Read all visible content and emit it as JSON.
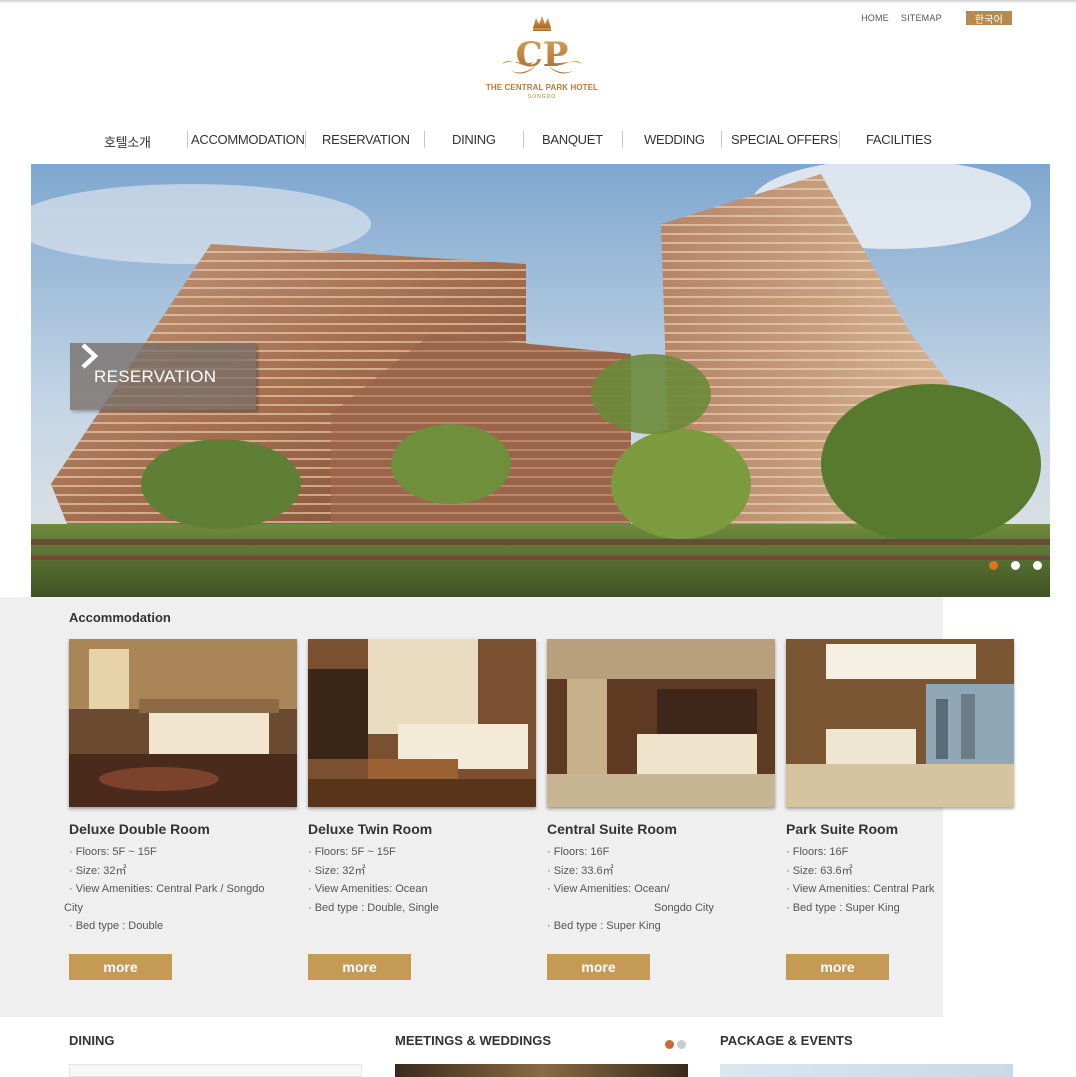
{
  "utility": {
    "home": "HOME",
    "sitemap": "SITEMAP",
    "language": "한국어"
  },
  "logo": {
    "monogram": "CP",
    "name": "THE CENTRAL PARK HOTEL",
    "location": "SONGDO"
  },
  "nav": [
    {
      "label": "호텔소개"
    },
    {
      "label": "ACCOMMODATION"
    },
    {
      "label": "RESERVATION"
    },
    {
      "label": "DINING"
    },
    {
      "label": "BANQUET"
    },
    {
      "label": "WEDDING"
    },
    {
      "label": "SPECIAL OFFERS"
    },
    {
      "label": "FACILITIES"
    }
  ],
  "hero": {
    "button_label": "RESERVATION",
    "slides": 3,
    "active_slide": 1
  },
  "accommodation": {
    "title": "Accommodation",
    "rooms": [
      {
        "name": "Deluxe Double Room",
        "specs": [
          "· Floors: 5F ~ 15F",
          "· Size: 32㎡",
          "· View Amenities: Central Park / Songdo",
          "City",
          "· Bed type : Double"
        ],
        "more": "more"
      },
      {
        "name": "Deluxe Twin Room",
        "specs": [
          "· Floors: 5F ~ 15F",
          "· Size: 32㎡",
          "· View Amenities: Ocean",
          "· Bed type : Double, Single"
        ],
        "more": "more"
      },
      {
        "name": "Central Suite Room",
        "specs": [
          "· Floors: 16F",
          "· Size: 33.6㎡",
          "· View Amenities: Ocean/",
          "Songdo City",
          "· Bed type : Super King"
        ],
        "more": "more"
      },
      {
        "name": "Park Suite Room",
        "specs": [
          "· Floors: 16F",
          "· Size: 63.6㎡",
          "· View Amenities: Central Park",
          "· Bed type : Super King"
        ],
        "more": "more"
      }
    ]
  },
  "bottom_sections": {
    "dining": "DINING",
    "meetings": "MEETINGS & WEDDINGS",
    "package": "PACKAGE & EVENTS"
  },
  "colors": {
    "gold": "#c49a55",
    "accent_dot": "#e0731f",
    "lang_bg": "#b58a4e"
  }
}
